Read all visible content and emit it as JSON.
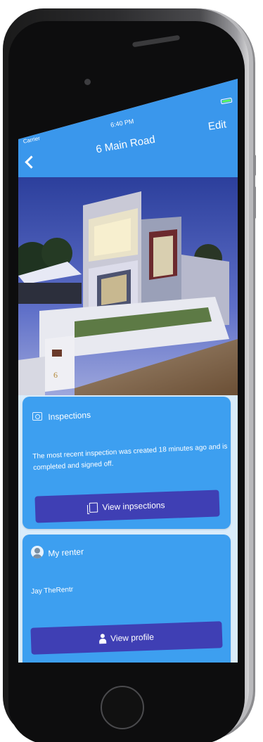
{
  "status_bar": {
    "carrier": "Carrier",
    "time": "6:40 PM"
  },
  "nav": {
    "title": "6 Main Road",
    "edit_label": "Edit"
  },
  "inspections_card": {
    "title": "Inspections",
    "description": "The most recent inspection was created 18 minutes ago and is completed and signed off.",
    "button_label": "View inpsections"
  },
  "renter_card": {
    "title": "My renter",
    "renter_name": "Jay TheRentr",
    "button_label": "View profile"
  },
  "house_number_sign": "6",
  "colors": {
    "nav_blue": "#3a97ec",
    "card_blue": "#3d9ff0",
    "button_indigo": "#3f3fb4",
    "battery_green": "#5dfc5d"
  }
}
